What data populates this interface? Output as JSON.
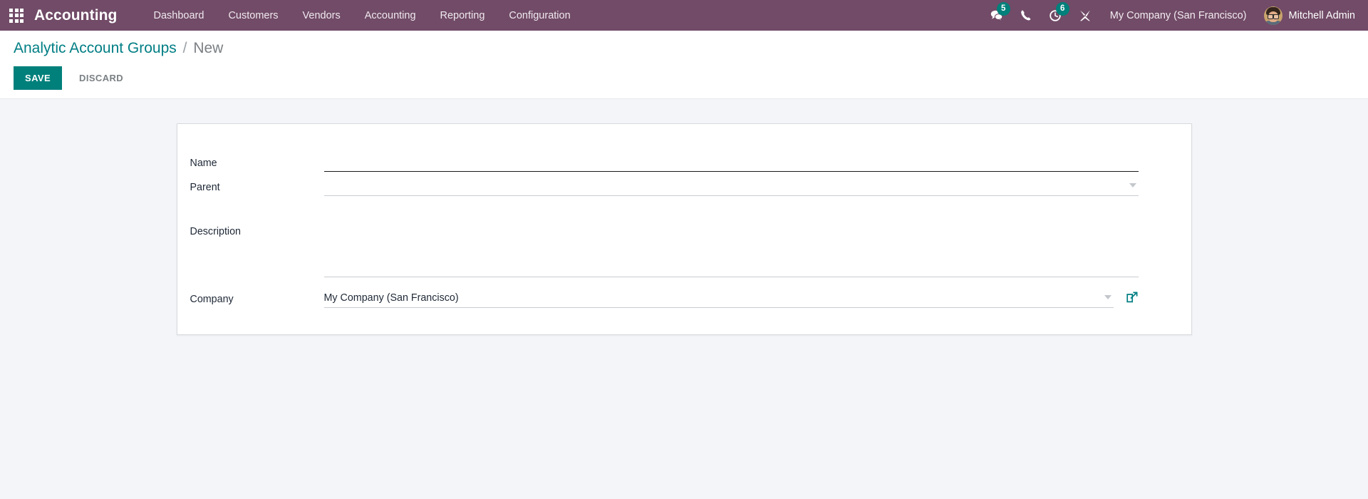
{
  "navbar": {
    "apps_icon": "apps-grid-icon",
    "brand": "Accounting",
    "menu": [
      {
        "label": "Dashboard"
      },
      {
        "label": "Customers"
      },
      {
        "label": "Vendors"
      },
      {
        "label": "Accounting"
      },
      {
        "label": "Reporting"
      },
      {
        "label": "Configuration"
      }
    ],
    "systray": [
      {
        "icon": "messages-icon",
        "badge": "5"
      },
      {
        "icon": "phone-icon",
        "badge": ""
      },
      {
        "icon": "activity-clock-icon",
        "badge": "6"
      },
      {
        "icon": "wrench-tools-icon",
        "badge": ""
      }
    ],
    "company_label": "My Company (San Francisco)",
    "user_name": "Mitchell Admin",
    "avatar_alt": "Mitchell Admin avatar",
    "bg_color": "#714b67",
    "badge_color": "#00807b"
  },
  "control_panel": {
    "breadcrumb_root": "Analytic Account Groups",
    "breadcrumb_separator": "/",
    "breadcrumb_current": "New",
    "save_label": "SAVE",
    "discard_label": "DISCARD",
    "save_color": "#00807b",
    "link_color": "#017e84"
  },
  "form": {
    "fields": [
      {
        "label": "Name",
        "type": "text",
        "value": "",
        "placeholder": "",
        "required": true
      },
      {
        "label": "Parent",
        "type": "many2one",
        "value": "",
        "placeholder": "",
        "required": false,
        "dropdown_icon": "chevron-down-icon"
      },
      {
        "label": "Description",
        "type": "textarea",
        "value": "",
        "placeholder": "",
        "required": false
      },
      {
        "label": "Company",
        "type": "many2one",
        "value": "My Company (San Francisco)",
        "placeholder": "",
        "required": false,
        "dropdown_icon": "chevron-down-icon",
        "external_link_icon": "external-link-icon",
        "external_link_color": "#017e84"
      }
    ]
  },
  "page": {
    "background": "#f4f5f8",
    "sheet_background": "#ffffff"
  }
}
